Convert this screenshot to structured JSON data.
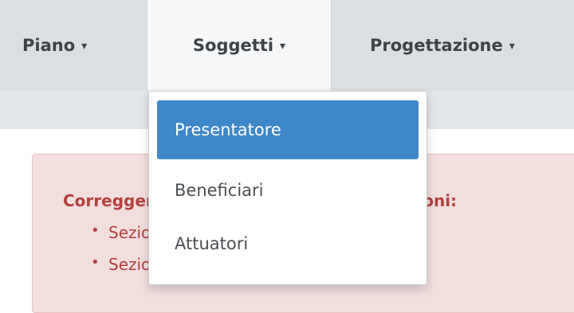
{
  "nav": {
    "items": [
      {
        "label": "Piano",
        "caret": "▾"
      },
      {
        "label": "Soggetti",
        "caret": "▾"
      },
      {
        "label": "Progettazione",
        "caret": "▾"
      }
    ]
  },
  "dropdown": {
    "items": [
      {
        "label": "Presentatore",
        "selected": true
      },
      {
        "label": "Beneficiari"
      },
      {
        "label": "Attuatori"
      }
    ]
  },
  "alert": {
    "title": "Correggere gli errori nelle seguenti sezioni:",
    "items": [
      "Sezione Presentatore -> Errori",
      "Sezione Presentatore -> Allegati"
    ]
  },
  "colors": {
    "navbar": "#dcdfe2",
    "active_tab": "#f6f7f8",
    "selected_item": "#3e87c9",
    "alert_bg": "#f3dede",
    "alert_text": "#b4403d"
  }
}
